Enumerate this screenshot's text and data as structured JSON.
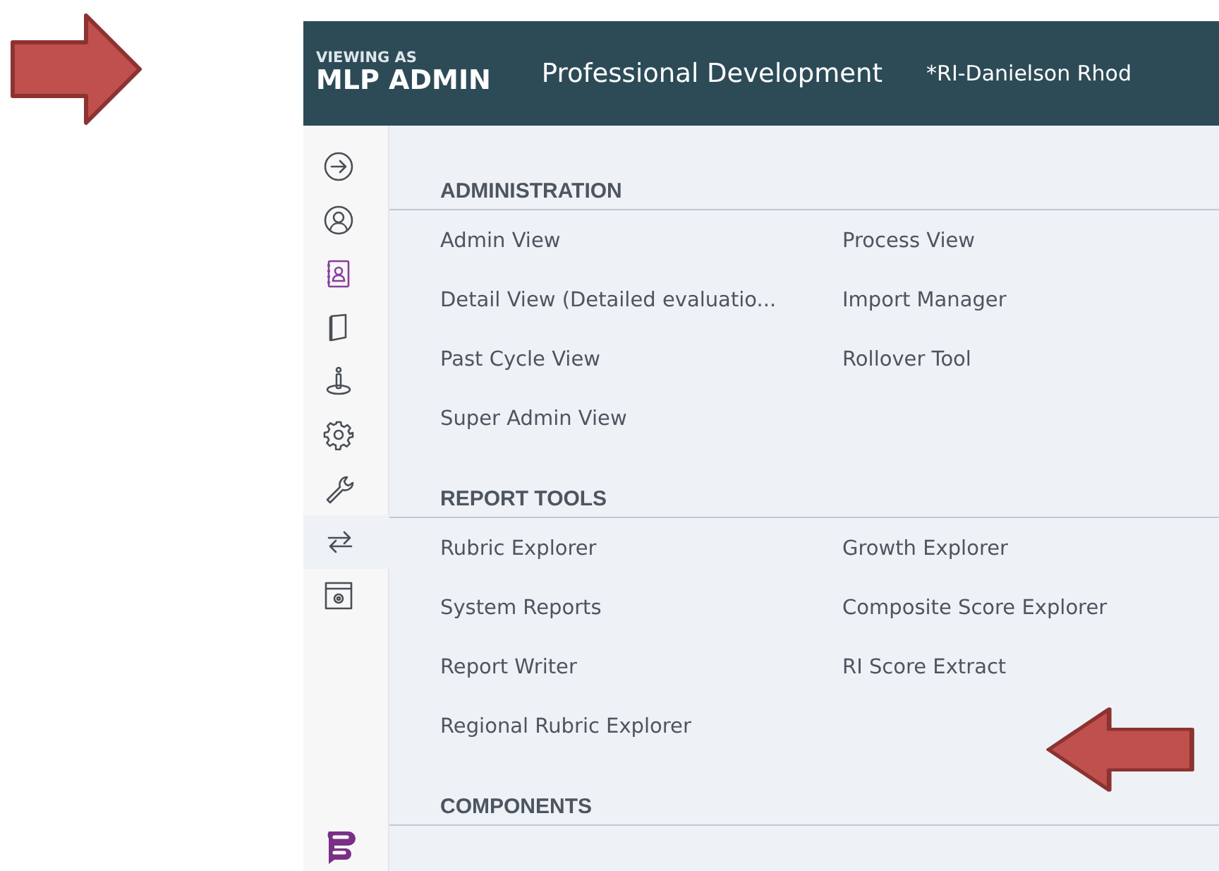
{
  "header": {
    "viewing_label": "VIEWING AS",
    "role": "MLP ADMIN",
    "app_title": "Professional Development",
    "context": "*RI-Danielson Rhod"
  },
  "sidebar": {
    "items": [
      {
        "kind": "arrow",
        "selected": false
      },
      {
        "kind": "profile",
        "selected": false
      },
      {
        "kind": "contacts",
        "selected": false
      },
      {
        "kind": "book",
        "selected": false
      },
      {
        "kind": "figure",
        "selected": false
      },
      {
        "kind": "gear",
        "selected": false
      },
      {
        "kind": "wrench",
        "selected": false
      },
      {
        "kind": "transfer",
        "selected": true
      },
      {
        "kind": "window-gear",
        "selected": false
      }
    ]
  },
  "sections": [
    {
      "title": "ADMINISTRATION",
      "items": [
        "Admin View",
        "Process View",
        "Detail View (Detailed evaluatio...",
        "Import Manager",
        "Past Cycle View",
        "Rollover Tool",
        "Super Admin View"
      ]
    },
    {
      "title": "REPORT TOOLS",
      "items": [
        "Rubric Explorer",
        "Growth Explorer",
        "System Reports",
        "Composite Score Explorer",
        "Report Writer",
        "RI Score Extract",
        "Regional Rubric Explorer"
      ]
    },
    {
      "title": "COMPONENTS"
    }
  ],
  "annotations": [
    {
      "kind": "arrow-right"
    },
    {
      "kind": "arrow-left"
    }
  ]
}
